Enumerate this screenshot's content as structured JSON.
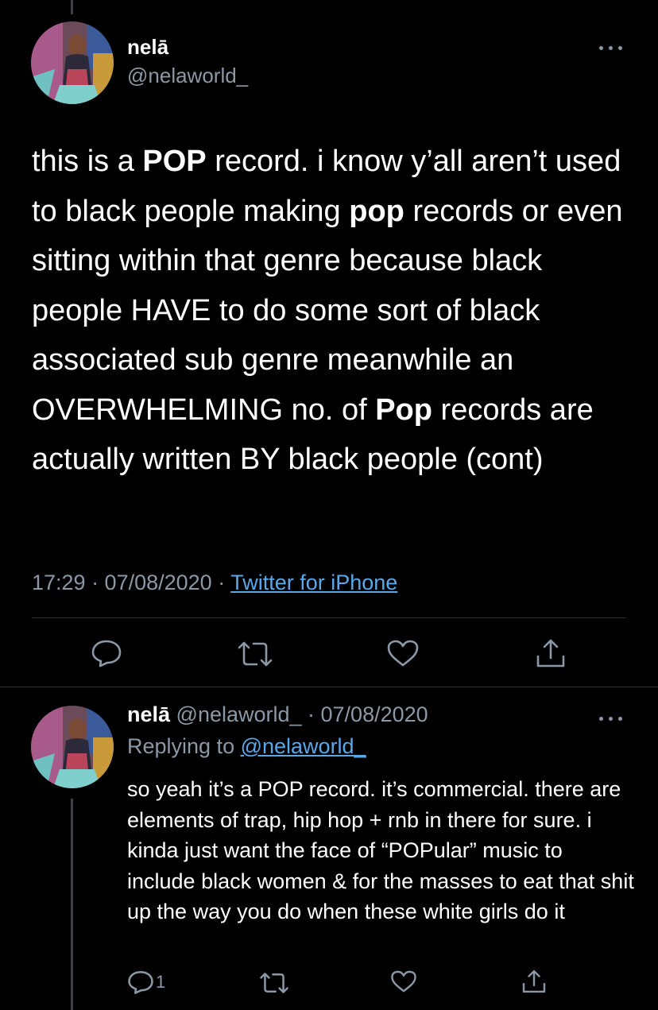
{
  "tweet": {
    "author_name": "nelā",
    "author_handle": "@nelaworld_",
    "text_parts": [
      {
        "t": "this is a ",
        "b": false
      },
      {
        "t": "POP",
        "b": true
      },
      {
        "t": " record. i know y’all aren’t used to black people making ",
        "b": false
      },
      {
        "t": "pop",
        "b": true
      },
      {
        "t": " records or even sitting within that genre because black people HAVE to do some sort of black associated sub genre meanwhile an OVERWHELMING no. of ",
        "b": false
      },
      {
        "t": "Pop",
        "b": true
      },
      {
        "t": " records are actually written BY black people (cont)",
        "b": false
      }
    ],
    "time": "17:29 · 07/08/2020 · ",
    "source": "Twitter for iPhone",
    "actions": {
      "reply_icon": "reply-icon",
      "retweet_icon": "retweet-icon",
      "like_icon": "like-icon",
      "share_icon": "share-icon"
    }
  },
  "reply": {
    "author_name": "nelā",
    "author_handle": " @nelaworld_",
    "date": " · 07/08/2020",
    "replying_prefix": "Replying to ",
    "replying_handle": "@nelaworld_",
    "text": "so yeah it’s a POP record. it’s commercial. there are elements of trap, hip hop + rnb in there for sure. i kinda just want the face of “POPular” music to include black women & for the masses to eat that shit up the way you do when these white girls do it",
    "reply_count": "1"
  },
  "colors": {
    "background": "#000000",
    "secondary_text": "#8b98a5",
    "link": "#5aa8e8",
    "divider": "#2f3336"
  }
}
